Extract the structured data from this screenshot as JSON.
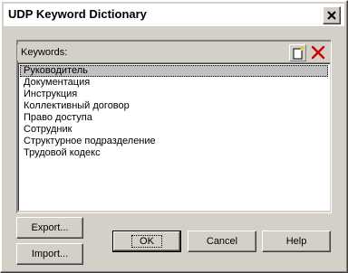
{
  "window": {
    "title": "UDP Keyword Dictionary"
  },
  "keywords": {
    "label": "Keywords:",
    "items": [
      "Руководитель",
      "Документация",
      "Инструкция",
      "Коллективный договор",
      "Право доступа",
      "Сотрудник",
      "Структурное подразделение",
      "Трудовой кодекс"
    ],
    "selected_index": 0
  },
  "buttons": {
    "export": "Export...",
    "import": "Import...",
    "ok": "OK",
    "cancel": "Cancel",
    "help": "Help"
  },
  "icons": {
    "new": "new-item-icon",
    "delete": "delete-icon",
    "close": "close-icon"
  },
  "colors": {
    "face": "#d4d0c8",
    "delete_red": "#cc0000",
    "selection": "#c0c0c0"
  }
}
